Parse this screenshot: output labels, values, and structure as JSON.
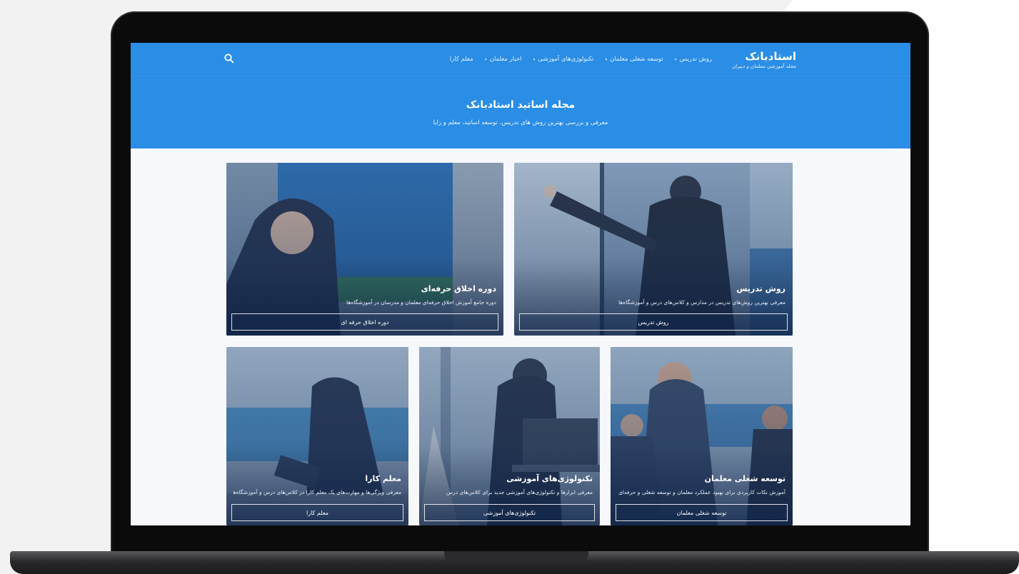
{
  "site": {
    "logo_title": "استادبانک",
    "logo_subtitle": "مجله آموزشی معلمان و دبیران"
  },
  "nav": {
    "items": [
      {
        "label": "روش تدریس",
        "icon": "chevron-down-icon"
      },
      {
        "label": "توسعه شغلی معلمان",
        "icon": "chevron-down-icon"
      },
      {
        "label": "تکنولوژی‌های آموزشی",
        "icon": "chevron-down-icon"
      },
      {
        "label": "اخبار معلمان",
        "icon": "chevron-down-icon"
      },
      {
        "label": "معلم کارا",
        "icon": "chevron-down-icon"
      }
    ],
    "search_icon": "search-icon"
  },
  "hero": {
    "title": "مجله اساتید استادبانک",
    "subtitle": "معرفی و بررسی بهترین روش های تدریس، توسعه اساتید، معلم و رایا"
  },
  "cards": [
    {
      "title": "روش تدریس",
      "description": "معرفی بهترین روش‌های تدریس در مدارس و کلاس‌های درس و آموزشگاه‌ها",
      "button": "روش تدریس"
    },
    {
      "title": "دوره اخلاق حرفه‌ای",
      "description": "دوره جامع آموزش اخلاق حرفه‌ای معلمان و مدرسان در آموزشگاه‌ها",
      "button": "دوره اخلاق حرفه ای"
    },
    {
      "title": "توسعه شغلی معلمان",
      "description": "آموزش نکات کاربردی برای بهبود عملکرد معلمان و توسعه شغلی و حرفه‌ای",
      "button": "توسعه شغلی معلمان"
    },
    {
      "title": "تکنولوژی‌های آموزشی",
      "description": "معرفی ابزارها و تکنولوژی‌های آموزشی جدید برای کلاس‌های درس",
      "button": "تکنولوژی‌های آموزشی"
    },
    {
      "title": "معلم کارا",
      "description": "معرفی ویژگی‌ها و مهارت‌های یک معلم کارا در کلاس‌های درس و آموزشگاه‌ها",
      "button": "معلم کارا"
    }
  ],
  "colors": {
    "brand_blue": "#2a8de6",
    "screen_bg": "#f7f8fb",
    "bezel": "#0b0b0c"
  }
}
